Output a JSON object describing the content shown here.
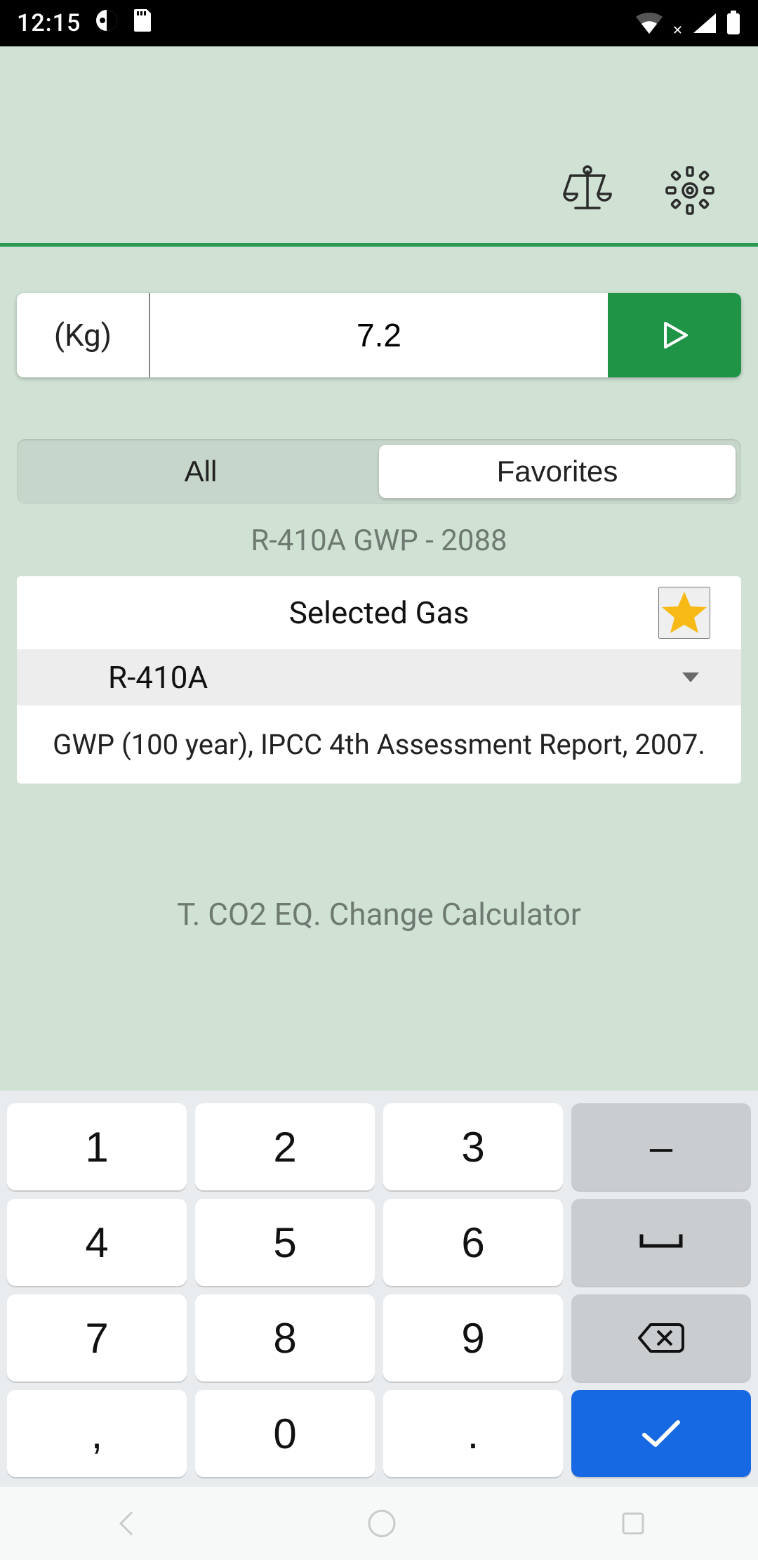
{
  "status": {
    "time": "12:15"
  },
  "toolbar": {
    "balance_icon": "balance-scale-icon",
    "settings_icon": "gear-icon"
  },
  "input": {
    "unit": "(Kg)",
    "value": "7.2"
  },
  "segmented": {
    "all": "All",
    "favorites": "Favorites",
    "active": "favorites"
  },
  "gwp_line": "R-410A GWP - 2088",
  "card": {
    "title": "Selected Gas",
    "gas": "R-410A",
    "footer": "GWP (100 year), IPCC 4th Assessment Report, 2007."
  },
  "calc_title": "T. CO2 EQ. Change Calculator",
  "keys": {
    "k1": "1",
    "k2": "2",
    "k3": "3",
    "k4": "4",
    "k5": "5",
    "k6": "6",
    "k7": "7",
    "k8": "8",
    "k9": "9",
    "comma": ",",
    "k0": "0",
    "dot": ".",
    "minus": "–"
  }
}
